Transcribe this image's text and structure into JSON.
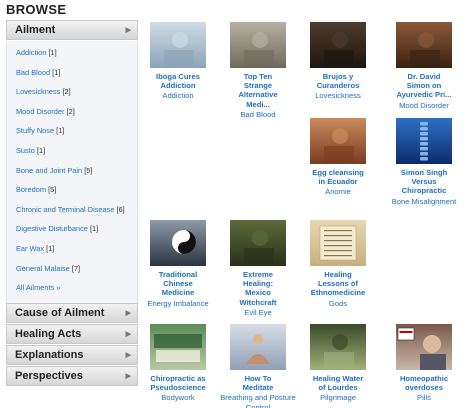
{
  "browse_title": "BROWSE",
  "sidebar": {
    "ailment_header": "Ailment",
    "ailment_items": [
      {
        "name": "Addiction",
        "count": "[1]"
      },
      {
        "name": "Bad Blood",
        "count": "[1]"
      },
      {
        "name": "Lovesickness",
        "count": "[2]"
      },
      {
        "name": "Mood Disorder",
        "count": "[2]"
      },
      {
        "name": "Stuffy Nose",
        "count": "[1]"
      },
      {
        "name": "Susto",
        "count": "[1]"
      },
      {
        "name": "Bone and Joint Pain",
        "count": "[5]"
      },
      {
        "name": "Boredom",
        "count": "[5]"
      },
      {
        "name": "Chronic and Terminal Disease",
        "count": "[6]"
      },
      {
        "name": "Digestive Disturbance",
        "count": "[1]"
      },
      {
        "name": "Ear Wax",
        "count": "[1]"
      },
      {
        "name": "General Malaise",
        "count": "[7]"
      }
    ],
    "all_ailments": "All Ailments »",
    "sections": [
      "Cause of Ailment",
      "Healing Acts",
      "Explanations",
      "Perspectives"
    ]
  },
  "videos": [
    {
      "title_lines": [
        "Ibogа Cures",
        "Addiction"
      ],
      "category": "Addiction",
      "thumb": "lab"
    },
    {
      "title_lines": [
        "Top Ten",
        "Strange",
        "Alternative",
        "Medi..."
      ],
      "category": "Bad Blood",
      "thumb": "collage"
    },
    {
      "title_lines": [
        "Brujos y",
        "Curanderos"
      ],
      "category": "Lovesickness",
      "thumb": "dark-room"
    },
    {
      "title_lines": [
        "Dr. David",
        "Simon on",
        "Ayurvedic Pri..."
      ],
      "category": "Mood Disorder",
      "thumb": "man-portrait"
    },
    {
      "title_lines": [
        "Egg cleansing",
        "in Ecuador"
      ],
      "category": "Anomie",
      "thumb": "egg"
    },
    {
      "title_lines": [
        "Simon Singh",
        "Versus",
        "Chiropractic"
      ],
      "category": "Bone Misalignment",
      "thumb": "spine"
    },
    {
      "title_lines": [
        "Traditional",
        "Chinese",
        "Medicine"
      ],
      "category": "Energy Imbalance",
      "thumb": "yin-yang"
    },
    {
      "title_lines": [
        "Extreme",
        "Healing:",
        "Mexico",
        "Witchcraft"
      ],
      "category": "Evil Eye",
      "thumb": "witchcraft"
    },
    {
      "title_lines": [
        "Healing",
        "Lessons of",
        "Ethnomedicine"
      ],
      "category": "Gods",
      "thumb": "book"
    },
    {
      "title_lines": [
        "Chiropractic as",
        "Pseudoscience"
      ],
      "category": "Bodywork",
      "thumb": "chiro"
    },
    {
      "title_lines": [
        "How To",
        "Meditate"
      ],
      "category": "Breathing and Posture Control",
      "thumb": "meditate"
    },
    {
      "title_lines": [
        "Healing Water",
        "of Lourdes"
      ],
      "category": "Pilgrimage",
      "thumb": "lourdes"
    },
    {
      "title_lines": [
        "Homeopathic",
        "overdoses"
      ],
      "category": "Pills",
      "thumb": "protest"
    }
  ],
  "thumb_colors": {
    "lab": [
      "#cfdce6",
      "#8aa4b8"
    ],
    "collage": [
      "#b5b0a2",
      "#6f6a5c"
    ],
    "dark-room": [
      "#4d3b2e",
      "#1e1611"
    ],
    "man-portrait": [
      "#8a5a3a",
      "#3a2212"
    ],
    "egg": [
      "#c98a5c",
      "#7a3c22"
    ],
    "spine": [
      "#2e6fc4",
      "#0c2c6a"
    ],
    "yin-yang": [
      "#8e9aa8",
      "#2b3440"
    ],
    "witchcraft": [
      "#5d6a3a",
      "#2a3018"
    ],
    "book": [
      "#e6d7b2",
      "#c7b07e"
    ],
    "chiro": [
      "#5e8a5a",
      "#b8c8a6"
    ],
    "meditate": [
      "#d8dde6",
      "#8fa0b6"
    ],
    "lourdes": [
      "#3a4a2a",
      "#a2b07a"
    ],
    "protest": [
      "#7a5a4a",
      "#c8b8a8"
    ]
  }
}
